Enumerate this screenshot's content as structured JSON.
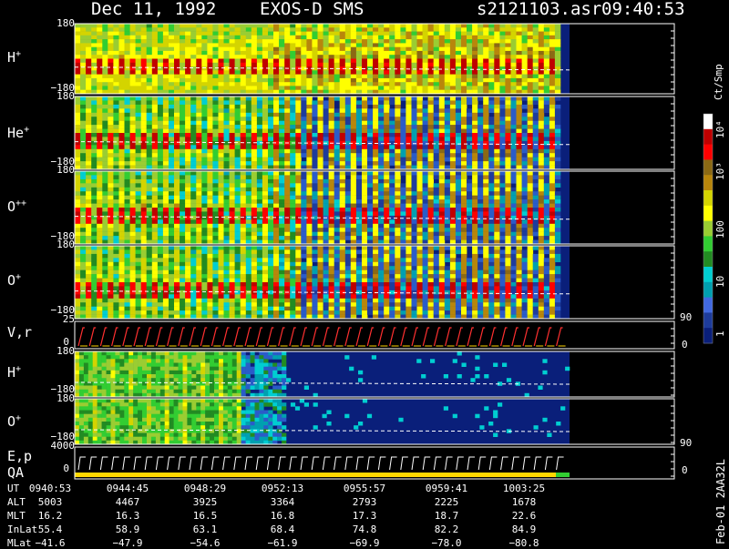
{
  "header": {
    "date": "Dec 11, 1992",
    "instrument": "EXOS-D SMS",
    "file": "s2121103.asr",
    "time": "09:40:53"
  },
  "panels": [
    {
      "id": "hplus",
      "label_base": "H",
      "label_sup": "+",
      "ytick_top": "180",
      "ytick_bottom": "−180",
      "intensity": "high"
    },
    {
      "id": "heplus",
      "label_base": "He",
      "label_sup": "+",
      "ytick_top": "180",
      "ytick_bottom": "−180",
      "intensity": "mid"
    },
    {
      "id": "oplusplus",
      "label_base": "O",
      "label_sup": "++",
      "ytick_top": "180",
      "ytick_bottom": "−180",
      "intensity": "mid"
    },
    {
      "id": "oplus",
      "label_base": "O",
      "label_sup": "+",
      "ytick_top": "180",
      "ytick_bottom": "−180",
      "intensity": "mid"
    },
    {
      "id": "vr",
      "label_base": "V,r",
      "label_sup": "",
      "ytick_top": "25",
      "ytick_bottom": "0",
      "right_top": "90",
      "right_bottom": "0"
    },
    {
      "id": "hplus2",
      "label_base": "H",
      "label_sup": "+",
      "ytick_top": "180",
      "ytick_bottom": "−180"
    },
    {
      "id": "oplus2",
      "label_base": "O",
      "label_sup": "+",
      "ytick_top": "180",
      "ytick_bottom": "−180"
    },
    {
      "id": "ep",
      "label_base": "E,p",
      "label_sup": "",
      "label2": "QA",
      "ytick_top": "4000",
      "ytick_bottom": "0",
      "right_top": "90",
      "right_bottom": "0"
    }
  ],
  "colorbar": {
    "unit": "Ct/Smp",
    "labels": [
      "10⁴",
      "10³",
      "100",
      "10",
      "1"
    ],
    "colors": [
      "#ffffff",
      "#c00000",
      "#ff0000",
      "#8b6914",
      "#b8860b",
      "#d4d400",
      "#ffff00",
      "#9acd32",
      "#32cd32",
      "#228b22",
      "#00ced1",
      "#00a0b0",
      "#4169e1",
      "#1e3c9c",
      "#0a1f7a"
    ]
  },
  "footer": {
    "rows": [
      {
        "label": "UT",
        "values": [
          "0940:53",
          "0944:45",
          "0948:29",
          "0952:13",
          "0955:57",
          "0959:41",
          "1003:25"
        ]
      },
      {
        "label": "ALT",
        "values": [
          "5003",
          "4467",
          "3925",
          "3364",
          "2793",
          "2225",
          "1678"
        ]
      },
      {
        "label": "MLT",
        "values": [
          "16.2",
          "16.3",
          "16.5",
          "16.8",
          "17.3",
          "18.7",
          "22.6"
        ]
      },
      {
        "label": "InLat",
        "values": [
          "55.4",
          "58.9",
          "63.1",
          "68.4",
          "74.8",
          "82.2",
          "84.9"
        ]
      },
      {
        "label": "MLat",
        "values": [
          "−41.6",
          "−47.9",
          "−54.6",
          "−61.9",
          "−69.9",
          "−78.0",
          "−80.8"
        ]
      }
    ]
  },
  "side_note": "Feb-01 2AA32L",
  "chart_data": {
    "type": "heatmap",
    "x": [
      "0940:53",
      "0944:45",
      "0948:29",
      "0952:13",
      "0955:57",
      "0959:41",
      "1003:25"
    ],
    "panels": [
      "H+",
      "He+",
      "O++",
      "O+",
      "V,r",
      "H+",
      "O+",
      "E,p QA"
    ],
    "colorbar_unit": "Ct/Smp",
    "colorbar_labels": [
      "10⁴",
      "10³",
      "100",
      "10",
      "1"
    ],
    "ylim": [
      -180,
      180
    ]
  }
}
